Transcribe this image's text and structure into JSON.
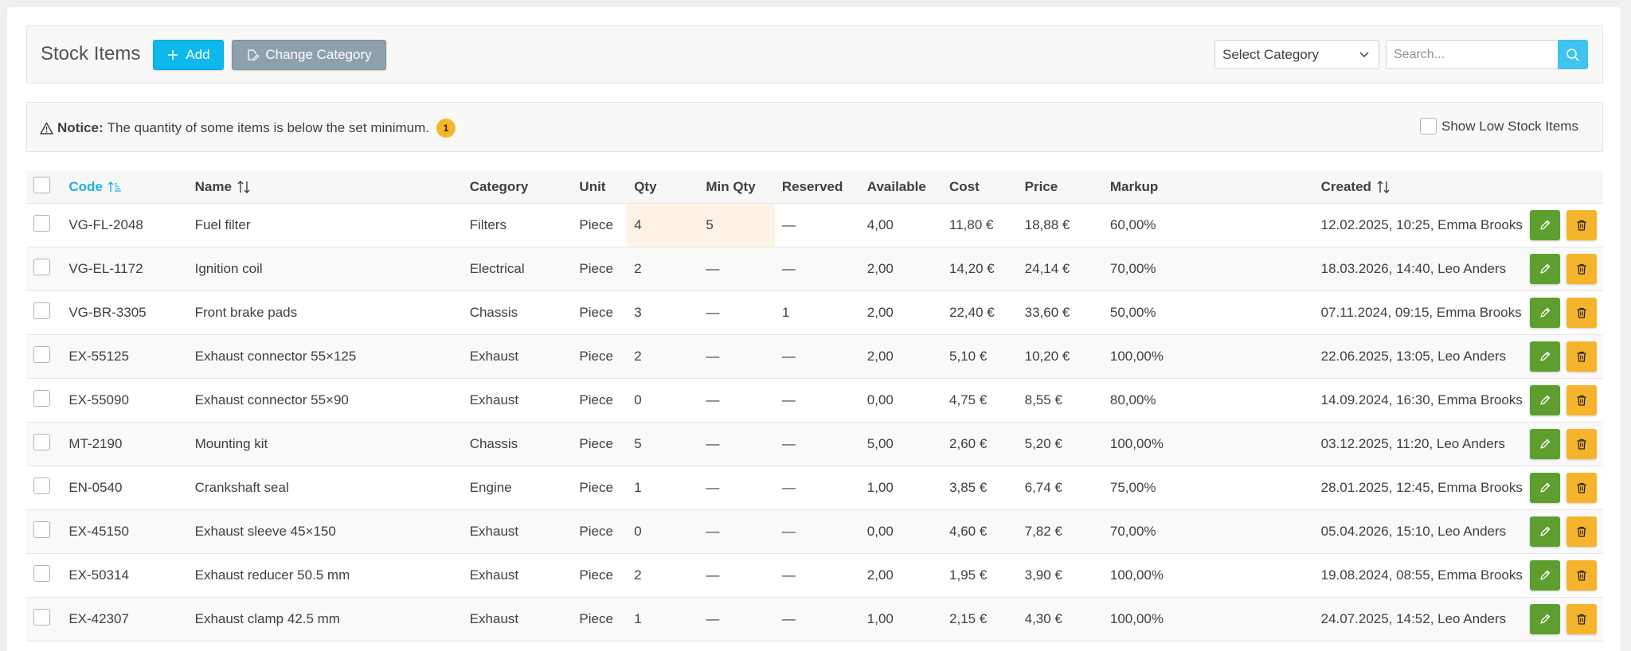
{
  "header": {
    "title": "Stock Items",
    "add_label": "Add",
    "change_category_label": "Change Category",
    "category_select": "Select Category",
    "search_placeholder": "Search..."
  },
  "notice": {
    "label": "Notice:",
    "text": "The quantity of some items is below the set minimum.",
    "count": "1",
    "show_low_stock_label": "Show Low Stock Items"
  },
  "table": {
    "columns": {
      "code": "Code",
      "name": "Name",
      "category": "Category",
      "unit": "Unit",
      "qty": "Qty",
      "min_qty": "Min Qty",
      "reserved": "Reserved",
      "available": "Available",
      "cost": "Cost",
      "price": "Price",
      "markup": "Markup",
      "created": "Created"
    },
    "rows": [
      {
        "code": "VG-FL-2048",
        "name": "Fuel filter",
        "category": "Filters",
        "unit": "Piece",
        "qty": "4",
        "min_qty": "5",
        "reserved": "—",
        "available": "4,00",
        "cost": "11,80 €",
        "price": "18,88 €",
        "markup": "60,00%",
        "created": "12.02.2025, 10:25, Emma Brooks",
        "low": true
      },
      {
        "code": "VG-EL-1172",
        "name": "Ignition coil",
        "category": "Electrical",
        "unit": "Piece",
        "qty": "2",
        "min_qty": "—",
        "reserved": "—",
        "available": "2,00",
        "cost": "14,20 €",
        "price": "24,14 €",
        "markup": "70,00%",
        "created": "18.03.2026, 14:40, Leo Anders",
        "low": false
      },
      {
        "code": "VG-BR-3305",
        "name": "Front brake pads",
        "category": "Chassis",
        "unit": "Piece",
        "qty": "3",
        "min_qty": "—",
        "reserved": "1",
        "available": "2,00",
        "cost": "22,40 €",
        "price": "33,60 €",
        "markup": "50,00%",
        "created": "07.11.2024, 09:15, Emma Brooks",
        "low": false
      },
      {
        "code": "EX-55125",
        "name": "Exhaust connector 55×125",
        "category": "Exhaust",
        "unit": "Piece",
        "qty": "2",
        "min_qty": "—",
        "reserved": "—",
        "available": "2,00",
        "cost": "5,10 €",
        "price": "10,20 €",
        "markup": "100,00%",
        "created": "22.06.2025, 13:05, Leo Anders",
        "low": false
      },
      {
        "code": "EX-55090",
        "name": "Exhaust connector 55×90",
        "category": "Exhaust",
        "unit": "Piece",
        "qty": "0",
        "min_qty": "—",
        "reserved": "—",
        "available": "0,00",
        "cost": "4,75 €",
        "price": "8,55 €",
        "markup": "80,00%",
        "created": "14.09.2024, 16:30, Emma Brooks",
        "low": false
      },
      {
        "code": "MT-2190",
        "name": "Mounting kit",
        "category": "Chassis",
        "unit": "Piece",
        "qty": "5",
        "min_qty": "—",
        "reserved": "—",
        "available": "5,00",
        "cost": "2,60 €",
        "price": "5,20 €",
        "markup": "100,00%",
        "created": "03.12.2025, 11:20, Leo Anders",
        "low": false
      },
      {
        "code": "EN-0540",
        "name": "Crankshaft seal",
        "category": "Engine",
        "unit": "Piece",
        "qty": "1",
        "min_qty": "—",
        "reserved": "—",
        "available": "1,00",
        "cost": "3,85 €",
        "price": "6,74 €",
        "markup": "75,00%",
        "created": "28.01.2025, 12:45, Emma Brooks",
        "low": false
      },
      {
        "code": "EX-45150",
        "name": "Exhaust sleeve 45×150",
        "category": "Exhaust",
        "unit": "Piece",
        "qty": "0",
        "min_qty": "—",
        "reserved": "—",
        "available": "0,00",
        "cost": "4,60 €",
        "price": "7,82 €",
        "markup": "70,00%",
        "created": "05.04.2026, 15:10, Leo Anders",
        "low": false
      },
      {
        "code": "EX-50314",
        "name": "Exhaust reducer 50.5 mm",
        "category": "Exhaust",
        "unit": "Piece",
        "qty": "2",
        "min_qty": "—",
        "reserved": "—",
        "available": "2,00",
        "cost": "1,95 €",
        "price": "3,90 €",
        "markup": "100,00%",
        "created": "19.08.2024, 08:55, Emma Brooks",
        "low": false
      },
      {
        "code": "EX-42307",
        "name": "Exhaust clamp 42.5 mm",
        "category": "Exhaust",
        "unit": "Piece",
        "qty": "1",
        "min_qty": "—",
        "reserved": "—",
        "available": "1,00",
        "cost": "2,15 €",
        "price": "4,30 €",
        "markup": "100,00%",
        "created": "24.07.2025, 14:52, Leo Anders",
        "low": false
      }
    ]
  },
  "colors": {
    "accent": "#0db8ec",
    "edit": "#5e9e2f",
    "delete": "#f6b42d",
    "warning_cell": "#fdf2e6"
  },
  "icons": {
    "add": "plus-icon",
    "change_category": "edit-category-icon",
    "select": "chevron-down-icon",
    "search": "search-icon",
    "notice": "warning-icon",
    "sort": "sort-icon",
    "edit": "pencil-icon",
    "delete": "trash-icon"
  }
}
